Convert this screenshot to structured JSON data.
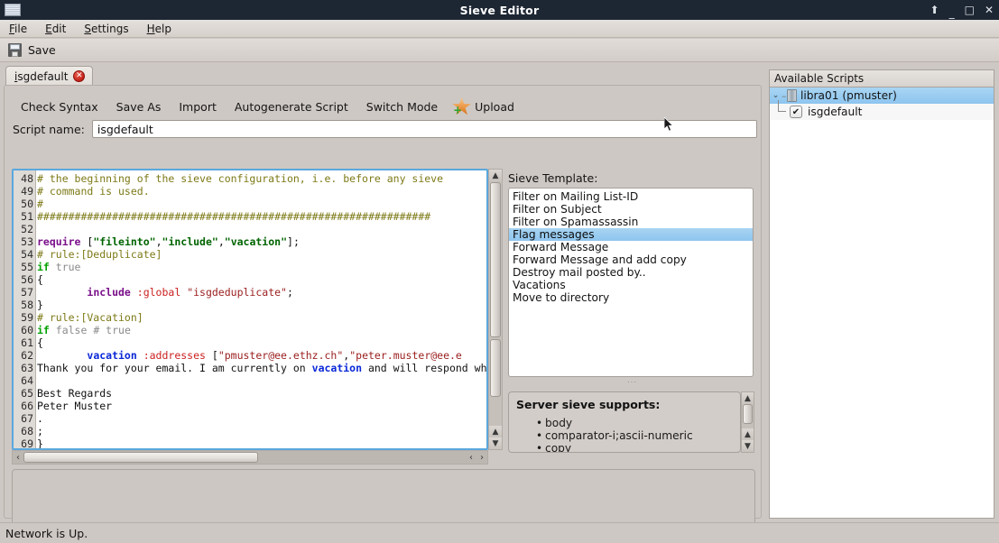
{
  "window": {
    "title": "Sieve Editor",
    "icon": "mail-icon",
    "controls": [
      {
        "name": "shade-button",
        "glyph": "⬆"
      },
      {
        "name": "minimize-button",
        "glyph": "_"
      },
      {
        "name": "maximize-button",
        "glyph": "□"
      },
      {
        "name": "close-button",
        "glyph": "✕"
      }
    ]
  },
  "menubar": {
    "items": [
      {
        "label": "File",
        "mnemonic": "F"
      },
      {
        "label": "Edit",
        "mnemonic": "E"
      },
      {
        "label": "Settings",
        "mnemonic": "S"
      },
      {
        "label": "Help",
        "mnemonic": "H"
      }
    ]
  },
  "toolbar": {
    "save_label": "Save",
    "save_icon": "floppy-disk-icon"
  },
  "tab": {
    "label": "isgdefault",
    "close_glyph": "✕"
  },
  "editor_toolbar": {
    "buttons": [
      "Check Syntax",
      "Save As",
      "Import",
      "Autogenerate Script",
      "Switch Mode"
    ],
    "upload_label": "Upload",
    "upload_icon": "star-upload-icon"
  },
  "script_name": {
    "label": "Script name:",
    "value": "isgdefault",
    "placeholder": ""
  },
  "code": {
    "first_line_number": 48,
    "lines": [
      {
        "n": 48,
        "tokens": [
          {
            "t": "comment",
            "s": "# the beginning of the sieve configuration, i.e. before any sieve"
          }
        ]
      },
      {
        "n": 49,
        "tokens": [
          {
            "t": "comment",
            "s": "# command is used."
          }
        ]
      },
      {
        "n": 50,
        "tokens": [
          {
            "t": "comment",
            "s": "#"
          }
        ]
      },
      {
        "n": 51,
        "tokens": [
          {
            "t": "comment",
            "s": "###############################################################"
          }
        ]
      },
      {
        "n": 52,
        "tokens": [
          {
            "t": "plain",
            "s": ""
          }
        ]
      },
      {
        "n": 53,
        "tokens": [
          {
            "t": "kw2",
            "s": "require"
          },
          {
            "t": "plain",
            "s": " ["
          },
          {
            "t": "str",
            "s": "\"fileinto\""
          },
          {
            "t": "plain",
            "s": ","
          },
          {
            "t": "str",
            "s": "\"include\""
          },
          {
            "t": "plain",
            "s": ","
          },
          {
            "t": "str",
            "s": "\"vacation\""
          },
          {
            "t": "plain",
            "s": "];"
          }
        ]
      },
      {
        "n": 54,
        "tokens": [
          {
            "t": "comment",
            "s": "# rule:[Deduplicate]"
          }
        ]
      },
      {
        "n": 55,
        "tokens": [
          {
            "t": "kw",
            "s": "if"
          },
          {
            "t": "gray",
            "s": " true"
          }
        ]
      },
      {
        "n": 56,
        "tokens": [
          {
            "t": "plain",
            "s": "{"
          }
        ]
      },
      {
        "n": 57,
        "tokens": [
          {
            "t": "plain",
            "s": "        "
          },
          {
            "t": "kw2",
            "s": "include"
          },
          {
            "t": "tag",
            "s": " :global"
          },
          {
            "t": "plain",
            "s": " "
          },
          {
            "t": "str2",
            "s": "\"isgdeduplicate\""
          },
          {
            "t": "plain",
            "s": ";"
          }
        ]
      },
      {
        "n": 58,
        "tokens": [
          {
            "t": "plain",
            "s": "}"
          }
        ]
      },
      {
        "n": 59,
        "tokens": [
          {
            "t": "comment",
            "s": "# rule:[Vacation]"
          }
        ]
      },
      {
        "n": 60,
        "tokens": [
          {
            "t": "kw",
            "s": "if"
          },
          {
            "t": "gray",
            "s": " false # true"
          }
        ]
      },
      {
        "n": 61,
        "tokens": [
          {
            "t": "plain",
            "s": "{"
          }
        ]
      },
      {
        "n": 62,
        "tokens": [
          {
            "t": "plain",
            "s": "        "
          },
          {
            "t": "cmd",
            "s": "vacation"
          },
          {
            "t": "tag",
            "s": " :addresses"
          },
          {
            "t": "plain",
            "s": " ["
          },
          {
            "t": "str2",
            "s": "\"pmuster@ee.ethz.ch\""
          },
          {
            "t": "plain",
            "s": ","
          },
          {
            "t": "str2",
            "s": "\"peter.muster@ee.e"
          }
        ]
      },
      {
        "n": 63,
        "tokens": [
          {
            "t": "plain",
            "s": "Thank you for your email. I am currently on "
          },
          {
            "t": "cmd",
            "s": "vacation"
          },
          {
            "t": "plain",
            "s": " and will respond wh"
          }
        ]
      },
      {
        "n": 64,
        "tokens": [
          {
            "t": "plain",
            "s": ""
          }
        ]
      },
      {
        "n": 65,
        "tokens": [
          {
            "t": "plain",
            "s": "Best Regards"
          }
        ]
      },
      {
        "n": 66,
        "tokens": [
          {
            "t": "plain",
            "s": "Peter Muster"
          }
        ]
      },
      {
        "n": 67,
        "tokens": [
          {
            "t": "plain",
            "s": "."
          }
        ]
      },
      {
        "n": 68,
        "tokens": [
          {
            "t": "plain",
            "s": ";"
          }
        ]
      },
      {
        "n": 69,
        "tokens": [
          {
            "t": "plain",
            "s": "}"
          }
        ]
      }
    ]
  },
  "template_panel": {
    "label": "Sieve Template:",
    "items": [
      "Filter on Mailing List-ID",
      "Filter on Subject",
      "Filter on Spamassassin",
      "Flag messages",
      "Forward Message",
      "Forward Message and add copy",
      "Destroy mail posted by..",
      "Vacations",
      "Move to directory"
    ],
    "selected": "Flag messages",
    "selected_index": 3,
    "selection_color": "#8ec5ef"
  },
  "supports_panel": {
    "title": "Server sieve supports:",
    "items": [
      "body",
      "comparator-i;ascii-numeric",
      "copy"
    ]
  },
  "scripts_panel": {
    "header": "Available Scripts",
    "server": {
      "label": "libra01 (pmuster)",
      "twisty": "⌄",
      "icon": "server-icon",
      "selected": true
    },
    "scripts": [
      {
        "label": "isgdefault",
        "checked": true,
        "check_glyph": "✔"
      }
    ]
  },
  "statusbar": {
    "text": "Network is Up."
  }
}
